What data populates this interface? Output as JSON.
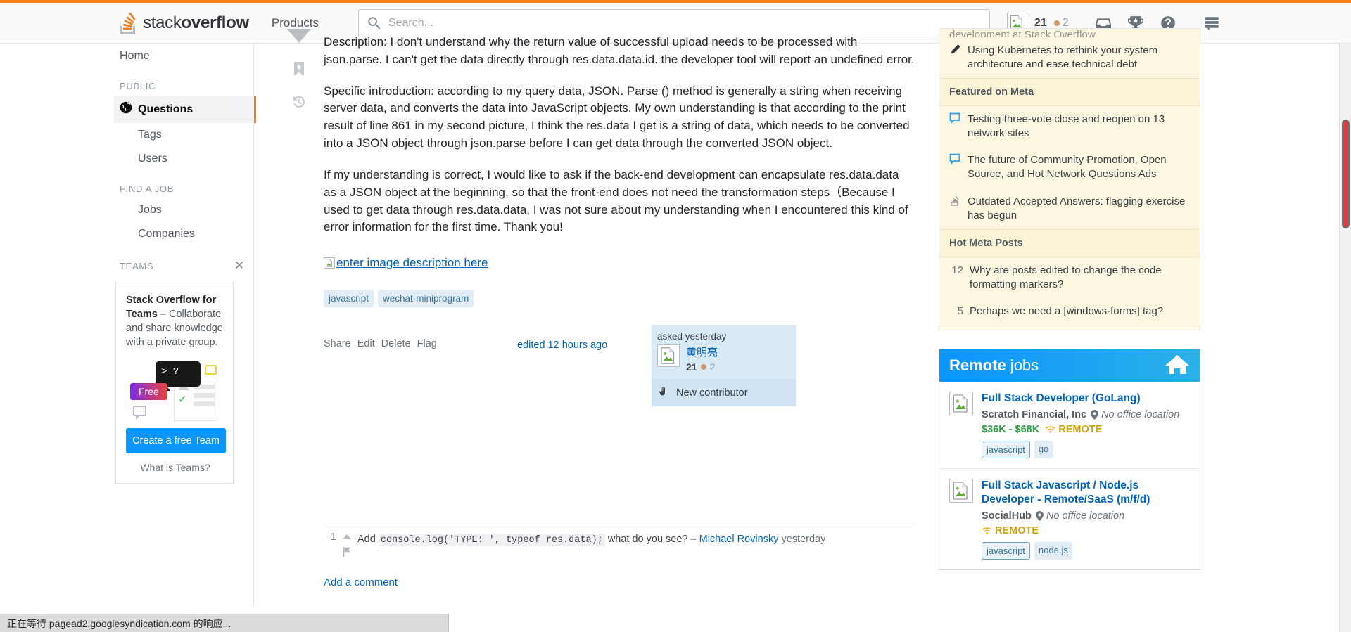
{
  "brand": {
    "name_light": "stack",
    "name_bold": "overflow",
    "accent": "#f48024"
  },
  "topnav": {
    "products_label": "Products",
    "search_placeholder": "Search...",
    "search_value": "",
    "reputation": "21",
    "badge_count": "2",
    "icons": [
      "inbox-icon",
      "trophy-icon",
      "help-icon",
      "site-switcher-icon"
    ]
  },
  "sidebar": {
    "home_label": "Home",
    "public_header": "PUBLIC",
    "questions_label": "Questions",
    "tags_label": "Tags",
    "users_label": "Users",
    "findjob_header": "FIND A JOB",
    "jobs_label": "Jobs",
    "companies_label": "Companies",
    "teams_header": "TEAMS",
    "teams_promo_bold": "Stack Overflow for Teams",
    "teams_promo_rest": " – Collaborate and share knowledge with a private group.",
    "teams_free_badge": "Free",
    "teams_terminal_glyph": ">_?",
    "create_team_label": "Create a free Team",
    "what_is_teams_label": "What is Teams?"
  },
  "post": {
    "paragraphs": [
      "Description: I don't understand why the return value of successful upload needs to be processed with json.parse. I can't get the data directly through res.data.data.id. the developer tool will report an undefined error.",
      "Specific introduction: according to my query data, JSON. Parse () method is generally a string when receiving server data, and converts the data into JavaScript objects. My own understanding is that according to the print result of line 861 in my second picture, I think the res.data I get is a string of data, which needs to be converted into a JSON object through json.parse before I can get data through the converted JSON object.",
      "If my understanding is correct, I would like to ask if the back-end development can encapsulate res.data.data as a JSON object at the beginning, so that the front-end does not need the transformation steps（Because I used to get data through res.data.data, I was not sure about my understanding when I encountered this kind of error information for the first time. Thank you!"
    ],
    "image_alt": "enter image description here",
    "tags": [
      "javascript",
      "wechat-miniprogram"
    ],
    "actions": [
      "Share",
      "Edit",
      "Delete",
      "Flag"
    ],
    "edited_label": "edited 12 hours ago",
    "vote_icons": [
      "downvote-arrow-icon",
      "bookmark-icon",
      "post-history-icon"
    ]
  },
  "usercard": {
    "asked_label": "asked yesterday",
    "username": "黄明亮",
    "reputation": "21",
    "badge_count": "2",
    "new_contributor_label": "New contributor",
    "new_contributor_icon": "hand-wave-icon"
  },
  "comments": {
    "items": [
      {
        "score": "1",
        "text_before": "Add",
        "code": "console.log('TYPE: ', typeof res.data);",
        "text_after": "what do you see? –",
        "user": "Michael Rovinsky",
        "when": "yesterday"
      }
    ],
    "add_comment_label": "Add a comment"
  },
  "rightbar": {
    "meta_cut_text": "development at Stack Overflow",
    "blog_item": {
      "icon": "pencil-icon",
      "title": "Using Kubernetes to rethink your system architecture and ease technical debt"
    },
    "featured_header": "Featured on Meta",
    "featured_items": [
      {
        "icon": "speech-bubble-icon",
        "title": "Testing three-vote close and reopen on 13 network sites"
      },
      {
        "icon": "speech-bubble-icon",
        "title": "The future of Community Promotion, Open Source, and Hot Network Questions Ads"
      },
      {
        "icon": "stacks-icon",
        "title": "Outdated Accepted Answers: flagging exercise has begun"
      }
    ],
    "hotmeta_header": "Hot Meta Posts",
    "hotmeta_items": [
      {
        "score": "12",
        "title": "Why are posts edited to change the code formatting markers?"
      },
      {
        "score": "5",
        "title": "Perhaps we need a [windows-forms] tag?"
      }
    ],
    "jobs": {
      "title_bold": "Remote",
      "title_light": " jobs",
      "header_icon": "house-icon",
      "items": [
        {
          "title": "Full Stack Developer (GoLang)",
          "company": "Scratch Financial, Inc",
          "location": "No office location",
          "salary": "$36K - $68K",
          "remote_label": "REMOTE",
          "tags": [
            "javascript",
            "go"
          ]
        },
        {
          "title": "Full Stack Javascript / Node.js Developer - Remote/SaaS (m/f/d)",
          "company": "SocialHub",
          "location": "No office location",
          "salary": "",
          "remote_label": "REMOTE",
          "tags": [
            "javascript",
            "node.js"
          ]
        }
      ]
    }
  },
  "statusbar": {
    "text": "正在等待 pagead2.googlesyndication.com 的响应..."
  }
}
